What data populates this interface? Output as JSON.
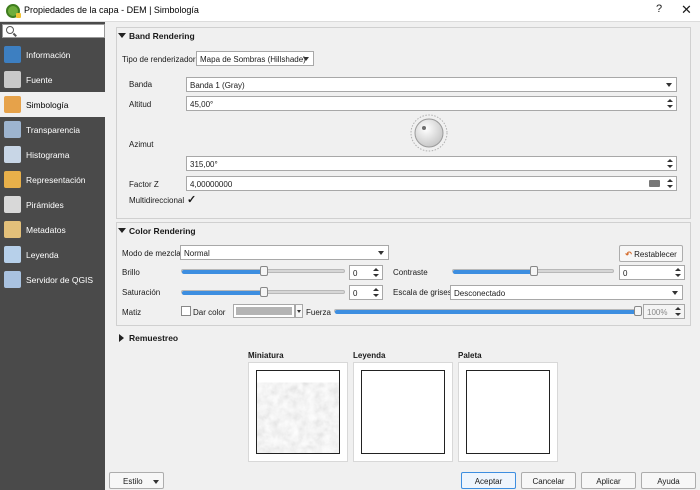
{
  "window": {
    "title": "Propiedades de la capa - DEM | Simbología",
    "help_label": "?",
    "close_label": "✕"
  },
  "sidebar": {
    "items": [
      {
        "label": "Información",
        "icon": "info-icon",
        "color": "#3d7fc1"
      },
      {
        "label": "Fuente",
        "icon": "wrench-icon",
        "color": "#c9c9c9"
      },
      {
        "label": "Simbología",
        "icon": "paintbrush-icon",
        "color": "#e6a24a",
        "active": true
      },
      {
        "label": "Transparencia",
        "icon": "transparency-icon",
        "color": "#9db4cf"
      },
      {
        "label": "Histograma",
        "icon": "histogram-icon",
        "color": "#c8d6e6"
      },
      {
        "label": "Representación",
        "icon": "brush-icon",
        "color": "#e8b04a"
      },
      {
        "label": "Pirámides",
        "icon": "pyramid-icon",
        "color": "#d8d8d8"
      },
      {
        "label": "Metadatos",
        "icon": "metadata-icon",
        "color": "#e3c07a"
      },
      {
        "label": "Leyenda",
        "icon": "legend-icon",
        "color": "#b7d0ea"
      },
      {
        "label": "Servidor de QGIS",
        "icon": "server-icon",
        "color": "#a9c2e0"
      }
    ]
  },
  "band_rendering": {
    "title": "Band Rendering",
    "renderer_label": "Tipo de renderizador",
    "renderer_value": "Mapa de Sombras (Hillshade)",
    "band_label": "Banda",
    "band_value": "Banda 1 (Gray)",
    "altitude_label": "Altitud",
    "altitude_value": "45,00°",
    "azimuth_label": "Azimut",
    "azimuth_value": "315,00°",
    "zfactor_label": "Factor Z",
    "zfactor_value": "4,00000000",
    "multidirectional_label": "Multidireccional",
    "multidirectional_checked": true
  },
  "color_rendering": {
    "title": "Color Rendering",
    "blend_label": "Modo de mezcla",
    "blend_value": "Normal",
    "reset_label": "Restablecer",
    "brightness_label": "Brillo",
    "brightness_value": "0",
    "contrast_label": "Contraste",
    "contrast_value": "0",
    "saturation_label": "Saturación",
    "saturation_value": "0",
    "grayscale_label": "Escala de grises",
    "grayscale_value": "Desconectado",
    "hue_label": "Matiz",
    "colorize_label": "Dar color",
    "strength_label": "Fuerza",
    "strength_value": "100%",
    "brightness_level": 0.5,
    "contrast_level": 0.5,
    "saturation_level": 0.5,
    "strength_level": 1.0
  },
  "resampling": {
    "title": "Remuestreo"
  },
  "previews": {
    "thumbnail_label": "Miniatura",
    "legend_label": "Leyenda",
    "palette_label": "Paleta"
  },
  "footer": {
    "style_label": "Estilo",
    "accept_label": "Aceptar",
    "cancel_label": "Cancelar",
    "apply_label": "Aplicar",
    "help_label": "Ayuda"
  }
}
